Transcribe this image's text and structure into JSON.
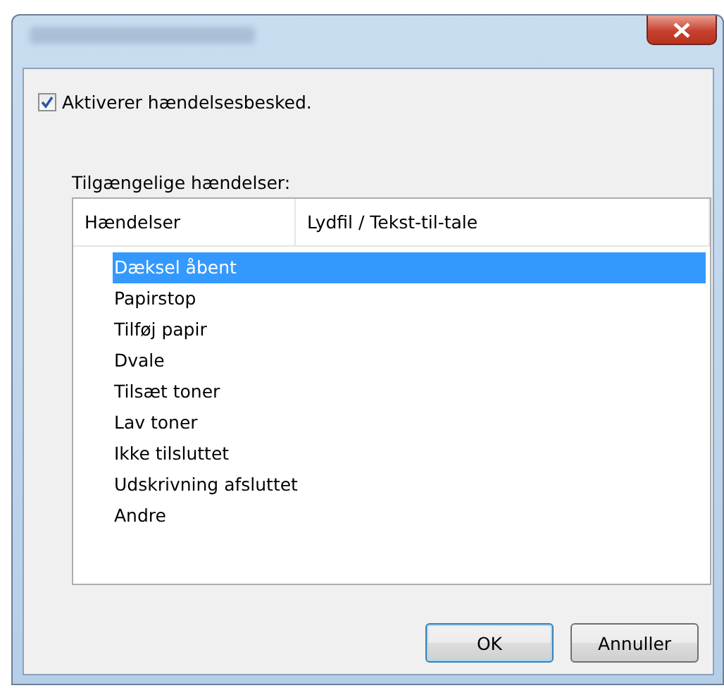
{
  "enable_checkbox": {
    "label": "Aktiverer hændelsesbesked.",
    "checked": true
  },
  "events_label": "Tilgængelige hændelser:",
  "table": {
    "columns": [
      "Hændelser",
      "Lydfil / Tekst-til-tale"
    ],
    "rows": [
      {
        "event": "Dæksel åbent",
        "selected": true
      },
      {
        "event": "Papirstop",
        "selected": false
      },
      {
        "event": "Tilføj papir",
        "selected": false
      },
      {
        "event": "Dvale",
        "selected": false
      },
      {
        "event": "Tilsæt toner",
        "selected": false
      },
      {
        "event": "Lav toner",
        "selected": false
      },
      {
        "event": "Ikke tilsluttet",
        "selected": false
      },
      {
        "event": "Udskrivning afsluttet",
        "selected": false
      },
      {
        "event": "Andre",
        "selected": false
      }
    ]
  },
  "buttons": [
    {
      "label": "OK",
      "default": true
    },
    {
      "label": "Annuller",
      "default": false
    }
  ]
}
